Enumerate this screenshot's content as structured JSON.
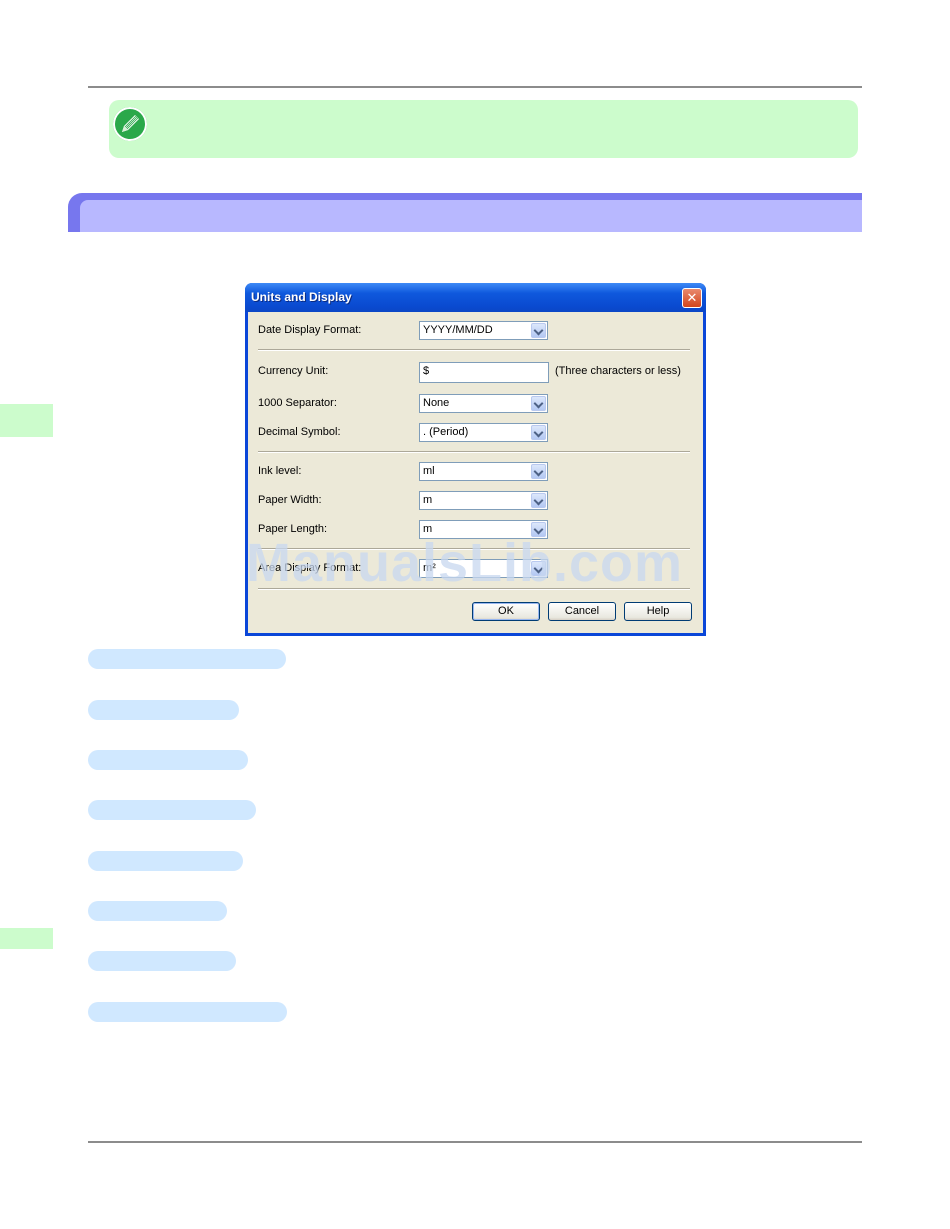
{
  "dialog": {
    "title": "Units and Display",
    "close_glyph": "✕",
    "fields": [
      {
        "label": "Date Display Format:",
        "value": "YYYY/MM/DD",
        "kind": "combo"
      },
      {
        "label": "Currency Unit:",
        "value": "$",
        "kind": "text",
        "hint": "(Three characters or less)"
      },
      {
        "label": "1000 Separator:",
        "value": "None",
        "kind": "combo"
      },
      {
        "label": "Decimal Symbol:",
        "value": ". (Period)",
        "kind": "combo"
      },
      {
        "label": "Ink level:",
        "value": "ml",
        "kind": "combo"
      },
      {
        "label": "Paper Width:",
        "value": "m",
        "kind": "combo"
      },
      {
        "label": "Paper Length:",
        "value": "m",
        "kind": "combo"
      },
      {
        "label": "Area Display Format:",
        "value": "m²",
        "kind": "combo"
      }
    ],
    "buttons": {
      "ok": "OK",
      "cancel": "Cancel",
      "help": "Help"
    }
  },
  "watermark": "ManualsLib.com",
  "icons": {
    "note": "pencil-note-icon"
  },
  "colors": {
    "note_bg": "#ccfccc",
    "section_bar": "#7777ee",
    "section_bar_inner": "#b8b8ff",
    "pill": "#d0e8ff",
    "titlebar": "#0a4ad0"
  }
}
